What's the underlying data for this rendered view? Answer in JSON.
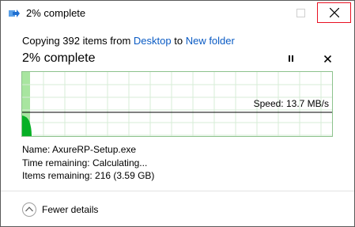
{
  "window": {
    "title": "2% complete"
  },
  "header": {
    "copy_prefix": "Copying 392 items from",
    "source": "Desktop",
    "to_word": "to",
    "destination": "New folder",
    "percent_text": "2% complete"
  },
  "progress": {
    "percent": 0.02
  },
  "graph": {
    "speed_label": "Speed: 13.7 MB/s"
  },
  "details": {
    "name_label": "Name:",
    "name_value": "AxureRP-Setup.exe",
    "time_label": "Time remaining:",
    "time_value": "Calculating...",
    "items_label": "Items remaining:",
    "items_value": "216 (3.59 GB)"
  },
  "footer": {
    "fewer_details_label": "Fewer details"
  },
  "colors": {
    "progress_fill": "#a8e5a0",
    "speed_area": "#06b025",
    "grid": "#d7ecd7",
    "link": "#0a5bc4",
    "close_highlight": "#e81123"
  },
  "icons": {
    "title_icon": "copy-arrow-icon",
    "pause": "pause-icon",
    "cancel": "close-icon",
    "fewer": "chevron-up-icon"
  }
}
